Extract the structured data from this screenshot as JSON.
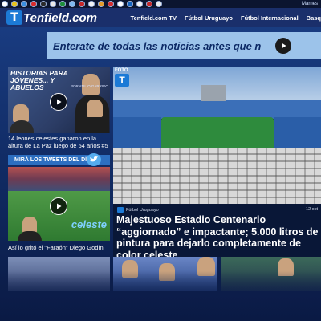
{
  "top_strip": {
    "city_label": "Marnes"
  },
  "header": {
    "logo_mark": "T",
    "logo_text": "Tenfield.com",
    "nav": [
      "Tenfield.com TV",
      "Fútbol Uruguayo",
      "Fútbol Internacional",
      "Basq"
    ]
  },
  "banner": {
    "text": "Enterate de todas las noticias antes que n"
  },
  "left_column": {
    "feature_card": {
      "title": "HISTORIAS PARA JÓVENES... Y ABUELOS",
      "author": "POR ATILIO GARRIDO",
      "caption": "14 leones celestes ganaron en la altura de La Paz luego de 54 años #5"
    },
    "tweets_bar": {
      "label": "MIRÁ LOS TWEETS DEL DÍA"
    },
    "video_card": {
      "overlay_word": "celeste",
      "caption": "Así lo gritó el \"Faraón\" Diego Godín"
    }
  },
  "main_story": {
    "badge": "FOTO",
    "badge_mark": "T",
    "category": "Fútbol Uruguayo",
    "date": "12 oct",
    "headline": "Majestuoso Estadio Centenario “aggiornado” e impactante; 5.000 litros de pintura para dejarlo completamente de color celeste"
  },
  "colors": {
    "background": "#102a62",
    "header": "#1a2f6b",
    "banner": "#9cc3ea",
    "accent": "#1c7ad6",
    "tweets_bar": "#2d6fc1"
  }
}
